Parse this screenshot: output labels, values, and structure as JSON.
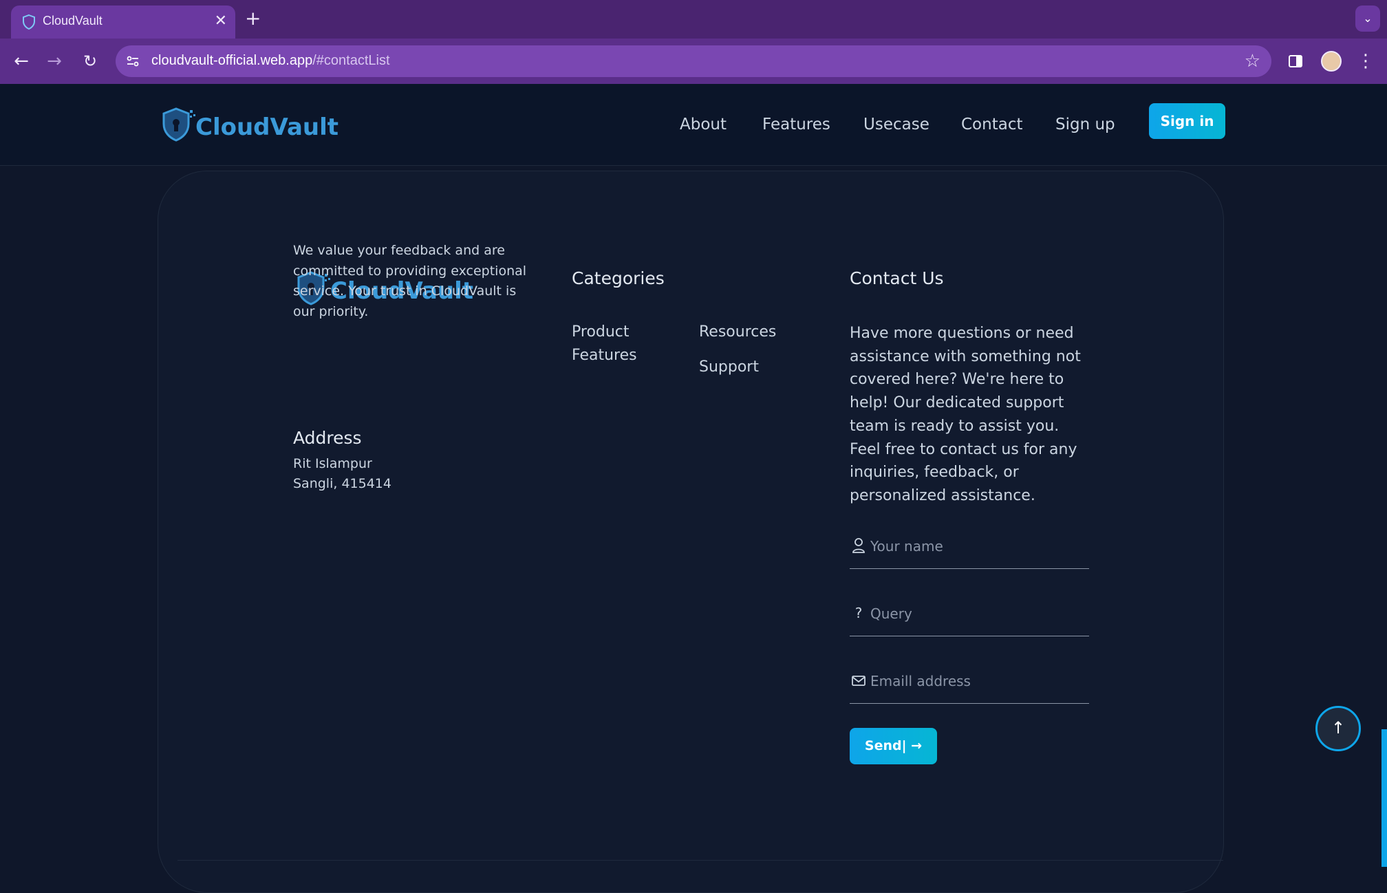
{
  "browser": {
    "tab_title": "CloudVault",
    "tab_close": "✕",
    "new_tab": "+",
    "url_host": "cloudvault-official.web.app",
    "url_path": "/#contactList"
  },
  "header": {
    "logo_text": "CloudVault",
    "nav": [
      "About",
      "Features",
      "Usecase",
      "Contact",
      "Sign up"
    ],
    "signin_label": "Sign in"
  },
  "footer": {
    "logo_text": "CloudVault",
    "about": "We value your feedback and are committed to providing exceptional service. Your trust in CloudVault is our priority.",
    "address_heading": "Address",
    "address_lines": [
      "Rit Islampur",
      "Sangli, 415414"
    ],
    "categories_heading": "Categories",
    "categories": [
      "Product",
      "Features",
      "Resources",
      "Support"
    ],
    "contact_heading": "Contact Us",
    "contact_text": "Have more questions or need assistance with something not covered here? We're here to help! Our dedicated support team is ready to assist you. Feel free to contact us for any inquiries, feedback, or personalized assistance.",
    "form": {
      "name_placeholder": "Your name",
      "query_placeholder": "Query",
      "email_placeholder": "Emaill address",
      "send_label": "Send| →"
    }
  },
  "colors": {
    "accent": "#0ea5e9",
    "brand_purple": "#5b2e8a",
    "background": "#0f172a"
  }
}
